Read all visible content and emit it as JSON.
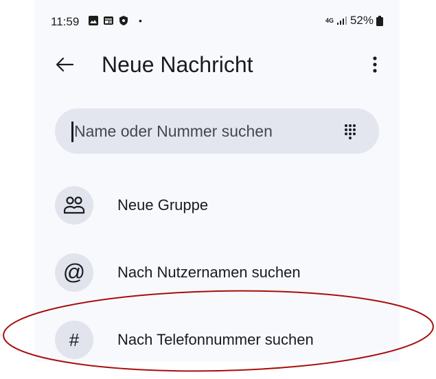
{
  "status_bar": {
    "time": "11:59",
    "dot": "•",
    "network": "4G",
    "battery": "52%"
  },
  "app_bar": {
    "title": "Neue Nachricht"
  },
  "search": {
    "placeholder": "Name oder Nummer suchen"
  },
  "items": [
    {
      "label": "Neue Gruppe",
      "icon": "group-icon"
    },
    {
      "label": "Nach Nutzernamen suchen",
      "icon": "at-icon",
      "glyph": "@"
    },
    {
      "label": "Nach Telefonnummer suchen",
      "icon": "hash-icon",
      "glyph": "#"
    }
  ],
  "colors": {
    "screen_bg": "#f8f9fd",
    "search_bg": "#e3e6ef",
    "icon_bg": "#e1e4ec",
    "annotation": "#a80c0c"
  }
}
